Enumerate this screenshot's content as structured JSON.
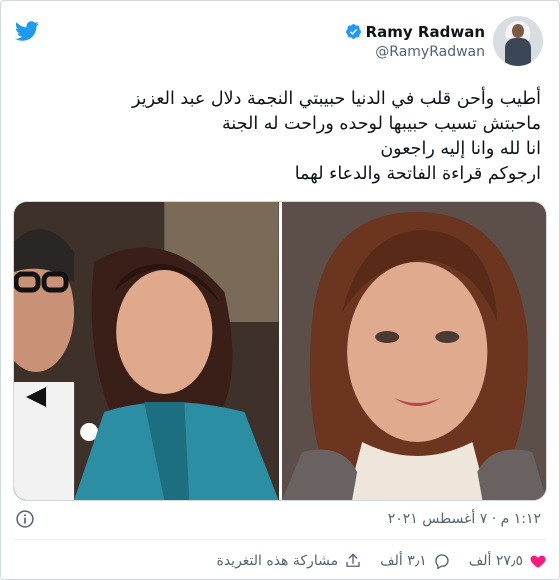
{
  "header": {
    "display_name": "Ramy Radwan",
    "handle": "@RamyRadwan"
  },
  "tweet": {
    "lines": [
      "أطيب وأحن قلب في الدنيا حبيبتي النجمة دلال عبد العزيز",
      "ماحبتش تسيب حبيبها لوحده وراحت له الجنة",
      "انا لله وانا إليه راجعون",
      "ارجوكم قراءة الفاتحة والدعاء لهما"
    ],
    "timestamp": "١:١٢ م · ٧ أغسطس ٢٠٢١"
  },
  "actions": {
    "likes": "٢٧٫٥ ألف",
    "replies": "٣٫١ ألف",
    "share_label": "مشاركة هذه التغريدة"
  },
  "icons": {
    "logo": "twitter-bird-icon",
    "verified": "verified-badge-icon",
    "info": "info-icon",
    "like": "heart-icon",
    "reply": "comment-icon",
    "share": "share-icon"
  },
  "colors": {
    "twitter_blue": "#1d9bf0",
    "secondary_text": "#536471"
  }
}
